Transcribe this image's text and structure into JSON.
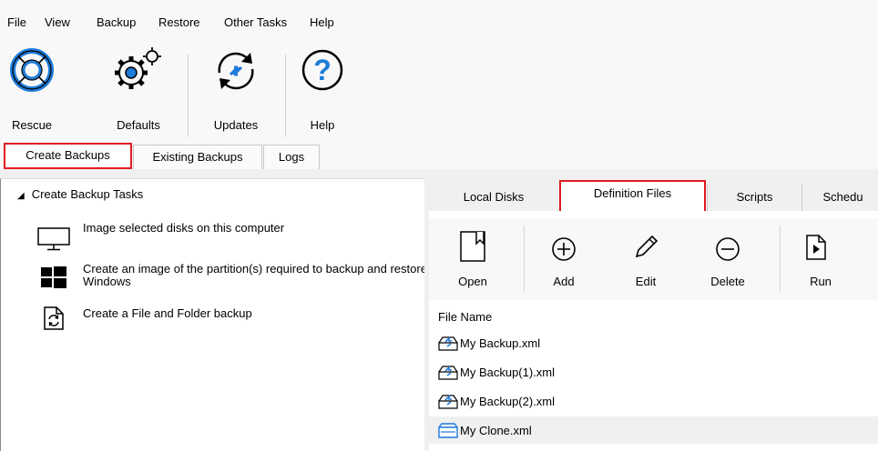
{
  "menu": {
    "items": [
      "File",
      "View",
      "Backup",
      "Restore",
      "Other Tasks",
      "Help"
    ]
  },
  "ribbon": {
    "rescue": "Rescue",
    "defaults": "Defaults",
    "updates": "Updates",
    "help": "Help"
  },
  "main_tabs": [
    "Create Backups",
    "Existing Backups",
    "Logs"
  ],
  "left": {
    "section_title": "Create Backup Tasks",
    "tasks": [
      "Image selected disks on this computer",
      "Create an image of the partition(s) required to backup and restore Windows",
      "Create a File and Folder backup"
    ]
  },
  "right_tabs": [
    "Local Disks",
    "Definition Files",
    "Scripts",
    "Schedu"
  ],
  "toolbar": {
    "open": "Open",
    "add": "Add",
    "edit": "Edit",
    "delete": "Delete",
    "run": "Run"
  },
  "files": {
    "header": "File Name",
    "rows": [
      {
        "name": "My Backup.xml",
        "icon": "backup-file-icon"
      },
      {
        "name": "My Backup(1).xml",
        "icon": "backup-file-icon"
      },
      {
        "name": "My Backup(2).xml",
        "icon": "backup-file-icon"
      },
      {
        "name": "My Clone.xml",
        "icon": "clone-file-icon"
      }
    ]
  },
  "colors": {
    "accent": "#1e7bd8",
    "highlight_border": "#e21b23"
  }
}
